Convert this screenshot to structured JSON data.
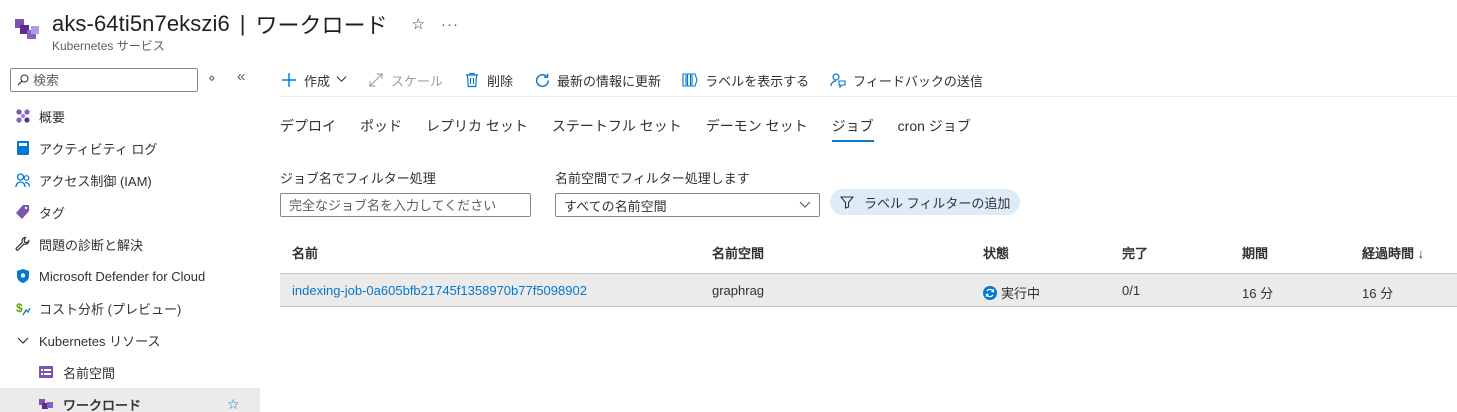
{
  "header": {
    "resource_name": "aks-64ti5n7ekszi6",
    "separator": "|",
    "page_name": "ワークロード",
    "subtitle": "Kubernetes サービス",
    "star_glyph": "☆",
    "more_glyph": "···"
  },
  "sidebar": {
    "search_placeholder": "検索",
    "ctrl_updown": "⋄",
    "ctrl_collapse": "«",
    "items": [
      {
        "label": "概要",
        "icon": "overview-icon"
      },
      {
        "label": "アクティビティ ログ",
        "icon": "activity-log-icon"
      },
      {
        "label": "アクセス制御 (IAM)",
        "icon": "iam-icon"
      },
      {
        "label": "タグ",
        "icon": "tag-icon"
      },
      {
        "label": "問題の診断と解決",
        "icon": "wrench-icon"
      },
      {
        "label": "Microsoft Defender for Cloud",
        "icon": "shield-icon"
      },
      {
        "label": "コスト分析 (プレビュー)",
        "icon": "cost-icon"
      },
      {
        "label": "Kubernetes リソース",
        "icon": "chevron-down-icon"
      },
      {
        "label": "名前空間",
        "icon": "namespace-icon"
      },
      {
        "label": "ワークロード",
        "icon": "workload-icon"
      }
    ],
    "active_star": "☆"
  },
  "toolbar": {
    "create": "作成",
    "scale": "スケール",
    "delete": "削除",
    "refresh": "最新の情報に更新",
    "show_labels": "ラベルを表示する",
    "feedback": "フィードバックの送信"
  },
  "tabs": [
    "デプロイ",
    "ポッド",
    "レプリカ セット",
    "ステートフル セット",
    "デーモン セット",
    "ジョブ",
    "cron ジョブ"
  ],
  "active_tab": "ジョブ",
  "filters": {
    "job_label": "ジョブ名でフィルター処理",
    "job_placeholder": "完全なジョブ名を入力してください",
    "ns_label": "名前空間でフィルター処理します",
    "ns_value": "すべての名前空間",
    "label_filter": "ラベル フィルターの追加"
  },
  "table": {
    "columns": [
      "名前",
      "名前空間",
      "状態",
      "完了",
      "期間",
      "経過時間 ↓"
    ],
    "rows": [
      {
        "name": "indexing-job-0a605bfb21745f1358970b77f5098902",
        "namespace": "graphrag",
        "status": "実行中",
        "completions": "0/1",
        "duration": "16 分",
        "age": "16 分"
      }
    ]
  },
  "colors": {
    "accent": "#0078d4",
    "selected_row": "#edebe9",
    "label_filter_bg": "#deecf9"
  }
}
